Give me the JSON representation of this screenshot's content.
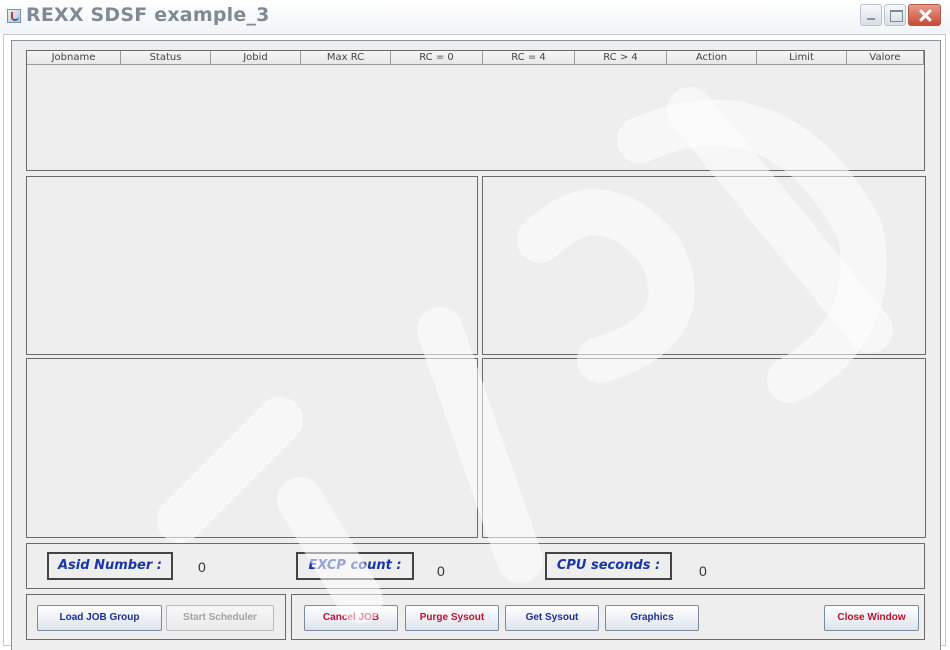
{
  "window": {
    "title": "REXX SDSF example_3"
  },
  "table": {
    "columns": [
      "Jobname",
      "Status",
      "Jobid",
      "Max RC",
      "RC = 0",
      "RC = 4",
      "RC > 4",
      "Action",
      "Limit",
      "Valore"
    ],
    "rows": []
  },
  "stats": {
    "asid_label": "Asid Number :",
    "asid_value": "0",
    "excp_label": "EXCP count :",
    "excp_value": "0",
    "cpu_label": "CPU seconds :",
    "cpu_value": "0"
  },
  "buttons": {
    "load_job_group": "Load JOB Group",
    "start_scheduler": "Start Scheduler",
    "cancel_job": "Cancel JOB",
    "purge_sysout": "Purge Sysout",
    "get_sysout": "Get Sysout",
    "graphics": "Graphics",
    "close_window": "Close Window"
  },
  "colors": {
    "label_blue": "#1a35a8",
    "button_red": "#c3102a",
    "button_blue": "#1a2f9a",
    "panel_bg": "#eeeeee"
  },
  "icons": {
    "app": "java-cup-icon",
    "minimize": "minimize-icon",
    "maximize": "maximize-icon",
    "close": "close-icon"
  }
}
